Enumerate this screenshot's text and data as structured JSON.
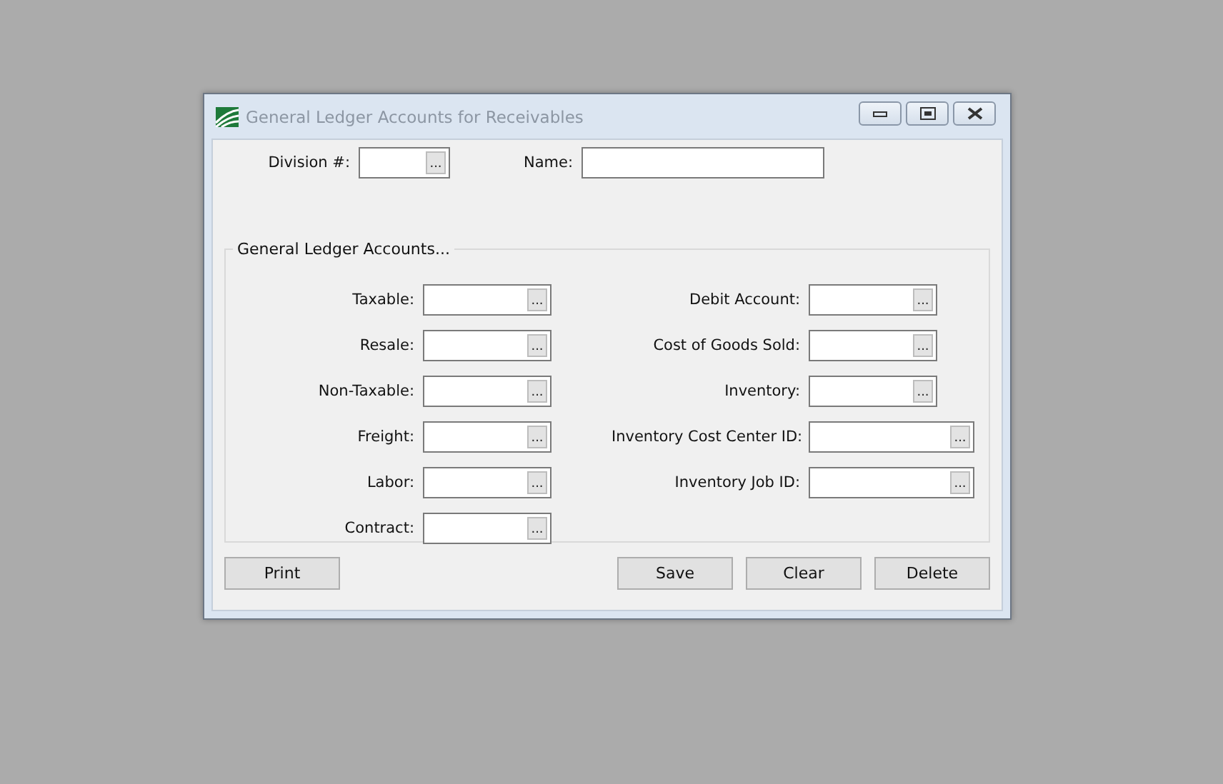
{
  "window": {
    "title": "General Ledger Accounts for Receivables"
  },
  "header_fields": [
    {
      "label": "Division #:",
      "kind": "lookup",
      "browse": "..."
    },
    {
      "label": "Name:",
      "kind": "text"
    }
  ],
  "group": {
    "title": "General Ledger Accounts...",
    "left_fields": [
      {
        "label": "Taxable:",
        "browse": "..."
      },
      {
        "label": "Resale:",
        "browse": "..."
      },
      {
        "label": "Non-Taxable:",
        "browse": "..."
      },
      {
        "label": "Freight:",
        "browse": "..."
      },
      {
        "label": "Labor:",
        "browse": "..."
      },
      {
        "label": "Contract:",
        "browse": "..."
      }
    ],
    "right_fields": [
      {
        "label": "Debit Account:",
        "kind": "short",
        "browse": "..."
      },
      {
        "label": "Cost of Goods Sold:",
        "kind": "short",
        "browse": "..."
      },
      {
        "label": "Inventory:",
        "kind": "short",
        "browse": "..."
      },
      {
        "label": "Inventory Cost Center ID:",
        "kind": "wide",
        "browse": "..."
      },
      {
        "label": "Inventory Job ID:",
        "kind": "wide",
        "browse": "..."
      }
    ]
  },
  "left_buttons": [
    "Print"
  ],
  "right_buttons": [
    "Save",
    "Clear",
    "Delete"
  ]
}
